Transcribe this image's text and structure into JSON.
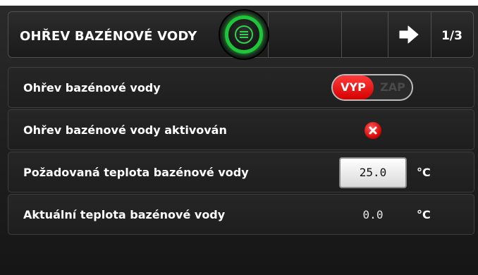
{
  "header": {
    "title": "OHŘEV BAZÉNOVÉ VODY",
    "page_indicator": "1/3",
    "menu_icon": "menu-icon",
    "next_icon": "arrow-right-icon"
  },
  "rows": [
    {
      "label": "Ohřev bazénové vody",
      "control": "toggle",
      "off_label": "VYP",
      "on_label": "ZAP",
      "state": "VYP"
    },
    {
      "label": "Ohřev bazénové vody aktivován",
      "control": "status",
      "status_icon": "error-x-icon"
    },
    {
      "label": "Požadovaná teplota bazénové vody",
      "control": "input",
      "value": "25.0",
      "unit": "°C"
    },
    {
      "label": "Aktuální teplota bazénové vody",
      "control": "readout",
      "value": "0.0",
      "unit": "°C"
    }
  ],
  "colors": {
    "accent_green": "#1ec63a",
    "toggle_red": "#e60000",
    "status_red": "#d30000",
    "background": "#1e1e1e"
  }
}
